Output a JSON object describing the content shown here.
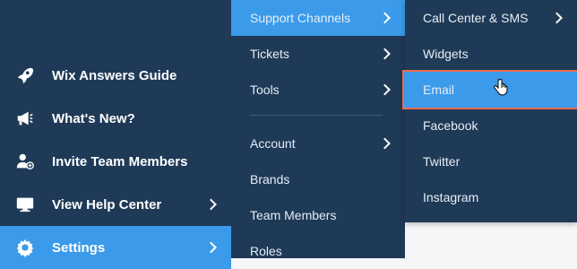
{
  "sidebar": {
    "items": [
      {
        "label": "Wix Answers Guide",
        "icon": "rocket-icon"
      },
      {
        "label": "What's New?",
        "icon": "megaphone-icon"
      },
      {
        "label": "Invite Team Members",
        "icon": "add-user-icon"
      },
      {
        "label": "View Help Center",
        "icon": "monitor-icon"
      },
      {
        "label": "Settings",
        "icon": "gear-icon"
      }
    ]
  },
  "submenu": {
    "items": [
      {
        "label": "Support Channels"
      },
      {
        "label": "Tickets"
      },
      {
        "label": "Tools"
      },
      {
        "label": "Account"
      },
      {
        "label": "Brands"
      },
      {
        "label": "Team Members"
      },
      {
        "label": "Roles"
      }
    ]
  },
  "channels": {
    "items": [
      {
        "label": "Call Center & SMS"
      },
      {
        "label": "Widgets"
      },
      {
        "label": "Email"
      },
      {
        "label": "Facebook"
      },
      {
        "label": "Twitter"
      },
      {
        "label": "Instagram"
      }
    ]
  },
  "colors": {
    "background": "#1f3a57",
    "active": "#3b9bea",
    "highlight_border": "#ef6a4f"
  }
}
